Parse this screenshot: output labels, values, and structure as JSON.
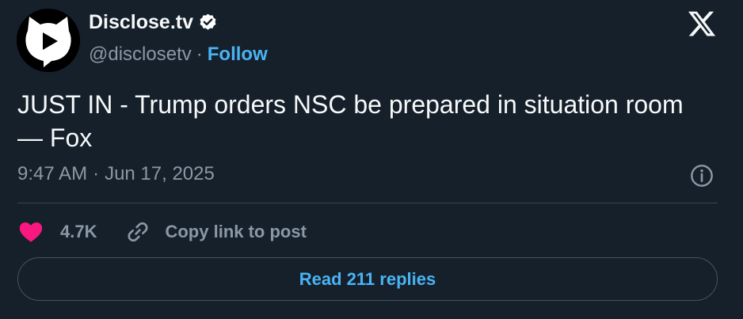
{
  "author": {
    "name": "Disclose.tv",
    "handle": "@disclosetv",
    "separator": "·",
    "follow_label": "Follow",
    "avatar_icon": "disclose-tv-logo-icon",
    "verified_icon": "verified-badge-icon"
  },
  "platform_icon": "x-logo-icon",
  "tweet": {
    "text": "JUST IN - Trump orders NSC be prepared in situation room — Fox",
    "time": "9:47 AM",
    "separator": "·",
    "date": "Jun 17, 2025"
  },
  "actions": {
    "like_count": "4.7K",
    "copy_link_label": "Copy link to post",
    "read_replies_label": "Read 211 replies"
  },
  "colors": {
    "background": "#15202b",
    "text_primary": "#f7f9f9",
    "text_secondary": "#8b98a5",
    "link": "#4ab3f4",
    "heart": "#f91880"
  }
}
